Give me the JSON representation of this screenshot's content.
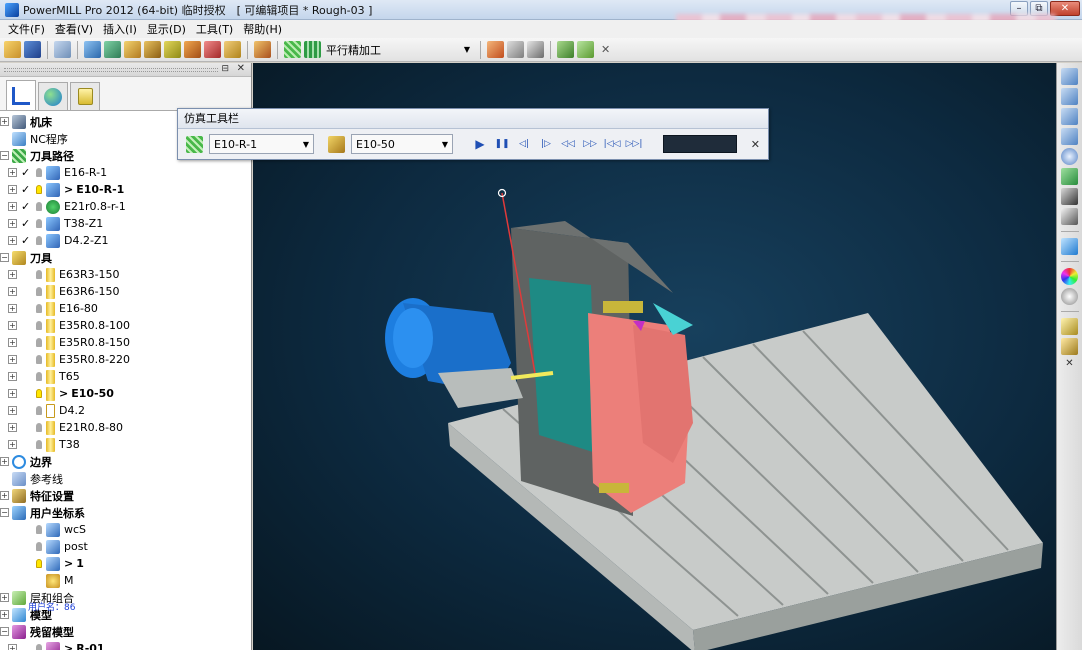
{
  "window": {
    "title": "PowerMILL Pro 2012 (64-bit) 临时授权　[ 可编辑项目 * Rough-03 ]",
    "buttons": {
      "minimize": "–",
      "restore": "⧉",
      "close": "✕"
    }
  },
  "menu": [
    "文件(F)",
    "查看(V)",
    "插入(I)",
    "显示(D)",
    "工具(T)",
    "帮助(H)"
  ],
  "toolbar": {
    "strategy_combo": "平行精加工",
    "close": "✕"
  },
  "explorer": {
    "head": {
      "pin": "⊟",
      "close": "✕"
    },
    "tree": [
      {
        "level": 0,
        "exp": "+",
        "icon": "machine-icon",
        "label": "机床",
        "bold": true
      },
      {
        "level": 0,
        "exp": "",
        "icon": "nc-program-icon",
        "label": "NC程序",
        "bold": false
      },
      {
        "level": 0,
        "exp": "−",
        "icon": "toolpath-icon",
        "label": "刀具路径",
        "bold": true
      },
      {
        "level": 1,
        "exp": "+",
        "check": "✓",
        "bulb": "off",
        "icon": "toolpath-item-icon",
        "label": "E16-R-1",
        "bold": false
      },
      {
        "level": 1,
        "exp": "+",
        "check": "✓",
        "bulb": "on",
        "icon": "toolpath-item-icon",
        "pre": ">",
        "label": "E10-R-1",
        "bold": true
      },
      {
        "level": 1,
        "exp": "+",
        "check": "✓",
        "bulb": "off",
        "icon": "toolpath-active-icon",
        "label": "E21r0.8-r-1",
        "bold": false
      },
      {
        "level": 1,
        "exp": "+",
        "check": "✓",
        "bulb": "off",
        "icon": "toolpath-item-icon",
        "label": "T38-Z1",
        "bold": false
      },
      {
        "level": 1,
        "exp": "+",
        "check": "✓",
        "bulb": "off",
        "icon": "toolpath-item-icon",
        "label": "D4.2-Z1",
        "bold": false
      },
      {
        "level": 0,
        "exp": "−",
        "icon": "tools-icon",
        "label": "刀具",
        "bold": true
      },
      {
        "level": 1,
        "exp": "+",
        "bulb": "off",
        "icon": "tool-item-icon",
        "label": "E63R3-150",
        "bold": false
      },
      {
        "level": 1,
        "exp": "+",
        "bulb": "off",
        "icon": "tool-item-icon",
        "label": "E63R6-150",
        "bold": false
      },
      {
        "level": 1,
        "exp": "+",
        "bulb": "off",
        "icon": "tool-item-icon",
        "label": "E16-80",
        "bold": false
      },
      {
        "level": 1,
        "exp": "+",
        "bulb": "off",
        "icon": "tool-item-icon",
        "label": "E35R0.8-100",
        "bold": false
      },
      {
        "level": 1,
        "exp": "+",
        "bulb": "off",
        "icon": "tool-item-icon",
        "label": "E35R0.8-150",
        "bold": false
      },
      {
        "level": 1,
        "exp": "+",
        "bulb": "off",
        "icon": "tool-item-icon",
        "label": "E35R0.8-220",
        "bold": false
      },
      {
        "level": 1,
        "exp": "+",
        "bulb": "off",
        "icon": "tool-item-icon",
        "label": "T65",
        "bold": false
      },
      {
        "level": 1,
        "exp": "+",
        "bulb": "on",
        "icon": "tool-item-icon",
        "pre": ">",
        "label": "E10-50",
        "bold": true
      },
      {
        "level": 1,
        "exp": "+",
        "bulb": "off",
        "icon": "tool-item-hollow-icon",
        "label": "D4.2",
        "bold": false
      },
      {
        "level": 1,
        "exp": "+",
        "bulb": "off",
        "icon": "tool-item-icon",
        "label": "E21R0.8-80",
        "bold": false
      },
      {
        "level": 1,
        "exp": "+",
        "bulb": "off",
        "icon": "tool-item-icon",
        "label": "T38",
        "bold": false
      },
      {
        "level": 0,
        "exp": "+",
        "icon": "boundary-icon",
        "label": "边界",
        "bold": true
      },
      {
        "level": 0,
        "exp": "",
        "icon": "pattern-icon",
        "label": "参考线",
        "bold": false
      },
      {
        "level": 0,
        "exp": "+",
        "icon": "feature-icon",
        "label": "特征设置",
        "bold": true
      },
      {
        "level": 0,
        "exp": "−",
        "icon": "workplane-icon",
        "label": "用户坐标系",
        "bold": true
      },
      {
        "level": 1,
        "exp": "",
        "bulb": "off",
        "icon": "workplane-item-icon",
        "label": "wcS",
        "bold": false
      },
      {
        "level": 1,
        "exp": "",
        "bulb": "off",
        "icon": "workplane-item-icon",
        "label": "post",
        "bold": false
      },
      {
        "level": 1,
        "exp": "",
        "bulb": "on",
        "icon": "workplane-item-icon",
        "pre": ">",
        "label": "1",
        "bold": true
      },
      {
        "level": 1,
        "exp": "",
        "bulb": "none",
        "icon": "workplane-star-icon",
        "label": "M",
        "bold": false
      },
      {
        "level": 0,
        "exp": "+",
        "icon": "level-icon",
        "label": "层和组合",
        "bold": false
      },
      {
        "level": 0,
        "exp": "+",
        "icon": "model-icon",
        "label": "模型",
        "bold": true
      },
      {
        "level": 0,
        "exp": "−",
        "icon": "stock-model-icon",
        "label": "残留模型",
        "bold": true
      },
      {
        "level": 1,
        "exp": "+",
        "bulb": "off",
        "icon": "stock-item-icon",
        "pre": ">",
        "label": "R-01",
        "bold": true
      }
    ],
    "overlay_text": "用户名：86"
  },
  "sim": {
    "title": "仿真工具栏",
    "toolpath": "E10-R-1",
    "tool": "E10-50",
    "controls": [
      "▶",
      "❚❚",
      "◁|",
      "|▷",
      "◁◁",
      "▷▷",
      "|◁◁",
      "▷▷|"
    ],
    "close": "✕"
  },
  "colors": {
    "viewport_bg": "#0d2a40",
    "table": "#c9ccca",
    "part_pink": "#ec7f7a",
    "part_teal": "#1f8c86",
    "head_blue": "#1d7ee0"
  }
}
